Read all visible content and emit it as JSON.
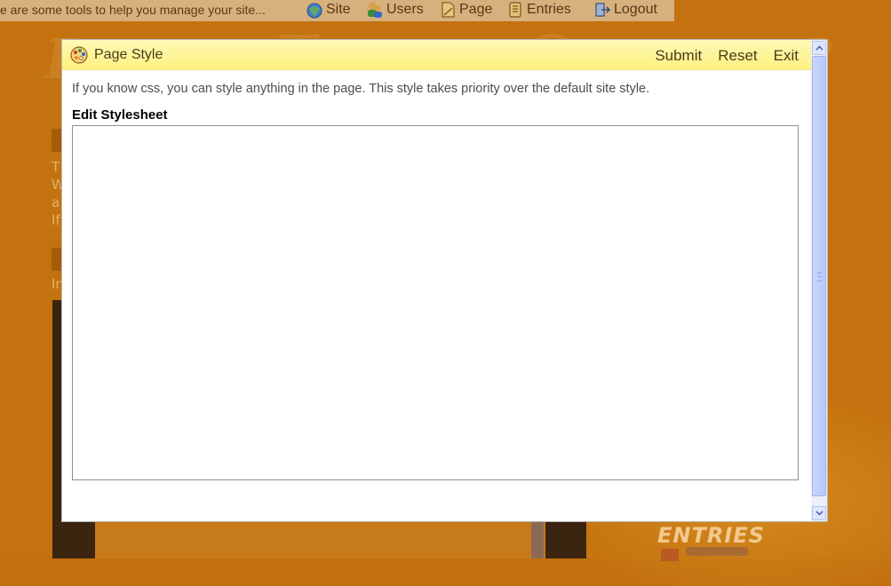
{
  "toolbar": {
    "message": "e are some tools to help you manage your site...",
    "items": [
      {
        "label": "Site",
        "icon": "site-globe-icon"
      },
      {
        "label": "Users",
        "icon": "users-icon"
      },
      {
        "label": "Page",
        "icon": "page-icon"
      },
      {
        "label": "Entries",
        "icon": "entries-icon"
      },
      {
        "label": "Logout",
        "icon": "logout-icon"
      }
    ]
  },
  "modal": {
    "title": "Page Style",
    "title_icon": "palette-icon",
    "actions": {
      "submit": "Submit",
      "reset": "Reset",
      "exit": "Exit"
    },
    "intro": "If you know css, you can style anything in the page. This style takes priority over the default site style.",
    "editor_label": "Edit Stylesheet",
    "editor_value": ""
  },
  "background": {
    "entries_heading": "ENTRIES"
  },
  "colors": {
    "page_bg": "#c4720f",
    "toolbar_bg": "#d6b07d",
    "header_gradient_top": "#fff9b8",
    "header_gradient_bottom": "#fdf07e",
    "scrollbar_thumb": "#b6c8fa"
  }
}
